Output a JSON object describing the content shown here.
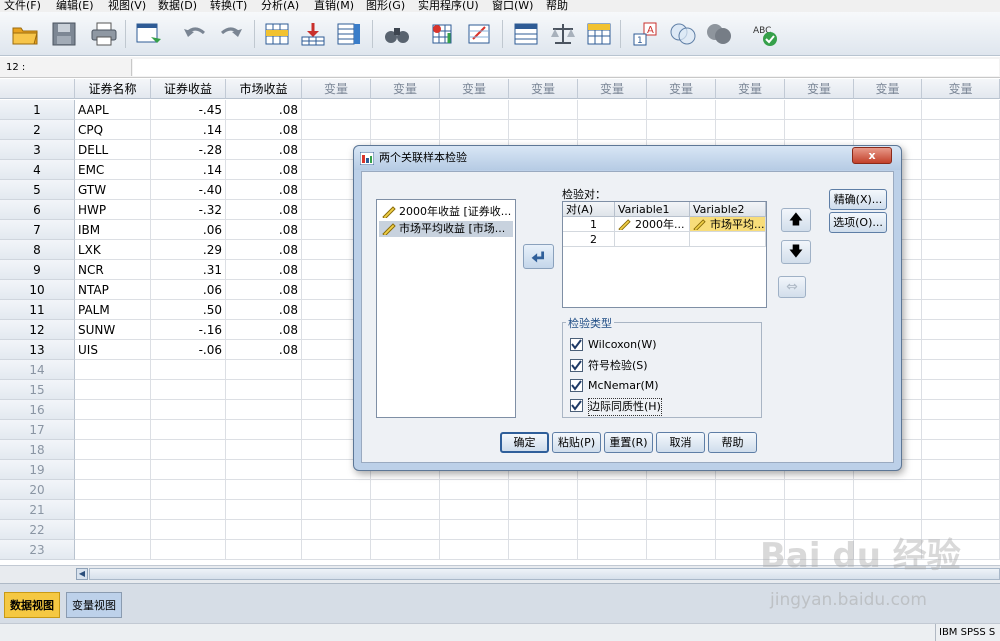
{
  "menu": [
    "文件(F)",
    "编辑(E)",
    "视图(V)",
    "数据(D)",
    "转换(T)",
    "分析(A)",
    "直销(M)",
    "图形(G)",
    "实用程序(U)",
    "窗口(W)",
    "帮助"
  ],
  "toolbar_icons": [
    "open-folder-icon",
    "save-icon",
    "print-icon",
    "dialog-recall-icon",
    "undo-icon",
    "redo-icon",
    "goto-case-icon",
    "goto-variable-icon",
    "variables-icon",
    "find-icon",
    "insert-cases-icon",
    "insert-variable-icon",
    "split-file-icon",
    "weight-cases-icon",
    "select-cases-icon",
    "value-labels-icon",
    "use-sets-icon",
    "show-all-variables-icon",
    "spelling-icon"
  ],
  "refbar": {
    "ref": "12 :",
    "value": ""
  },
  "grid": {
    "columns": [
      "证券名称",
      "证券收益",
      "市场收益",
      "变量",
      "变量",
      "变量",
      "变量",
      "变量",
      "变量",
      "变量",
      "变量",
      "变量",
      "变量"
    ],
    "row_numbers": [
      "1",
      "2",
      "3",
      "4",
      "5",
      "6",
      "7",
      "8",
      "9",
      "10",
      "11",
      "12",
      "13",
      "14",
      "15",
      "16",
      "17",
      "18",
      "19",
      "20",
      "21",
      "22",
      "23"
    ],
    "rows": [
      [
        "AAPL",
        "-.45",
        ".08"
      ],
      [
        "CPQ",
        ".14",
        ".08"
      ],
      [
        "DELL",
        "-.28",
        ".08"
      ],
      [
        "EMC",
        ".14",
        ".08"
      ],
      [
        "GTW",
        "-.40",
        ".08"
      ],
      [
        "HWP",
        "-.32",
        ".08"
      ],
      [
        "IBM",
        ".06",
        ".08"
      ],
      [
        "LXK",
        ".29",
        ".08"
      ],
      [
        "NCR",
        ".31",
        ".08"
      ],
      [
        "NTAP",
        ".06",
        ".08"
      ],
      [
        "PALM",
        ".50",
        ".08"
      ],
      [
        "SUNW",
        "-.16",
        ".08"
      ],
      [
        "UIS",
        "-.06",
        ".08"
      ]
    ]
  },
  "tabs": {
    "data_view": "数据视图",
    "variable_view": "变量视图"
  },
  "status": "IBM SPSS S",
  "watermark": {
    "line1": "Bai du 经验",
    "line2": "jingyan.baidu.com"
  },
  "dialog": {
    "title": "两个关联样本检验",
    "close_label": "x",
    "source_vars": [
      "2000年收益 [证券收...",
      "市场平均收益 [市场..."
    ],
    "pairs_label": "检验对：",
    "pair_headers": [
      "对(A)",
      "Variable1",
      "Variable2"
    ],
    "pair_rows": [
      {
        "n": "1",
        "v1": "2000年...",
        "v2": "市场平均..."
      },
      {
        "n": "2",
        "v1": "",
        "v2": ""
      }
    ],
    "exact_label": "精确(X)...",
    "options_label": "选项(O)...",
    "test_type_label": "检验类型",
    "tests": [
      "Wilcoxon(W)",
      "符号检验(S)",
      "McNemar(M)",
      "边际同质性(H)"
    ],
    "buttons": {
      "ok": "确定",
      "paste": "粘贴(P)",
      "reset": "重置(R)",
      "cancel": "取消",
      "help": "帮助"
    }
  },
  "colors": {
    "accent": "#1f4d85",
    "active_tab": "#f5c842",
    "selection": "#f8dd7a"
  }
}
